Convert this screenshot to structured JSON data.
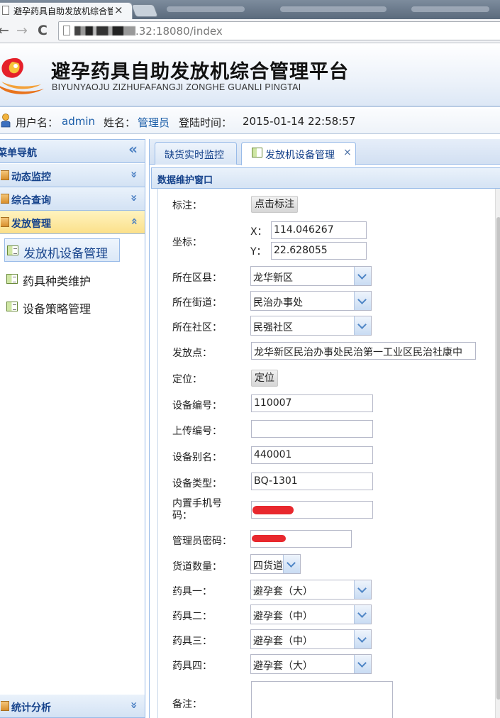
{
  "browser": {
    "tab_title": "避孕药具自助发放机综合管理平台",
    "tab_close": "×",
    "url_rest": ".32:18080/index",
    "nav_back": "←",
    "nav_forward": "→",
    "nav_reload": "C"
  },
  "header": {
    "title": "避孕药具自助发放机综合管理平台",
    "subtitle": "BIYUNYAOJU ZIZHUFAFANGJI ZONGHE GUANLI PINGTAI"
  },
  "userbar": {
    "username_label": "用户名：",
    "username": "admin",
    "name_label": "姓名：",
    "name": "管理员",
    "login_time_label": "登陆时间：",
    "login_time": "2015-01-14 22:58:57"
  },
  "sidebar": {
    "title": "菜单导航",
    "collapse_icon": "«",
    "groups": [
      {
        "label": "动态监控",
        "chevron": "»"
      },
      {
        "label": "综合查询",
        "chevron": "»"
      },
      {
        "label": "发放管理",
        "chevron": "»"
      },
      {
        "label": "统计分析",
        "chevron": "»"
      }
    ],
    "items": [
      {
        "label": "发放机设备管理"
      },
      {
        "label": "药具种类维护"
      },
      {
        "label": "设备策略管理"
      }
    ]
  },
  "tabs": [
    {
      "label": "缺货实时监控"
    },
    {
      "label": "发放机设备管理",
      "close": "×"
    }
  ],
  "window": {
    "title": "数据维护窗口"
  },
  "form": {
    "mark_label": "标注：",
    "mark_button": "点击标注",
    "coord_label": "坐标：",
    "x_label": "X：",
    "x_value": "114.046267",
    "y_label": "Y：",
    "y_value": "22.628055",
    "district_label": "所在区县：",
    "district_value": "龙华新区",
    "street_label": "所在街道：",
    "street_value": "民治办事处",
    "community_label": "所在社区：",
    "community_value": "民强社区",
    "point_label": "发放点：",
    "point_value": "龙华新区民治办事处民治第一工业区民治社康中",
    "locate_label": "定位：",
    "locate_button": "定位",
    "device_no_label": "设备编号：",
    "device_no_value": "110007",
    "upload_no_label": "上传编号：",
    "upload_no_value": "",
    "alias_label": "设备别名：",
    "alias_value": "440001",
    "type_label": "设备类型：",
    "type_value": "BQ-1301",
    "phone_label_1": "内置手机号",
    "phone_label_2": "码：",
    "password_label": "管理员密码：",
    "lanes_label": "货道数量：",
    "lanes_value": "四货道",
    "drug1_label": "药具一：",
    "drug1_value": "避孕套（大）",
    "drug2_label": "药具二：",
    "drug2_value": "避孕套（中）",
    "drug3_label": "药具三：",
    "drug3_value": "避孕套（中）",
    "drug4_label": "药具四：",
    "drug4_value": "避孕套（大）",
    "remark_label": "备注："
  }
}
